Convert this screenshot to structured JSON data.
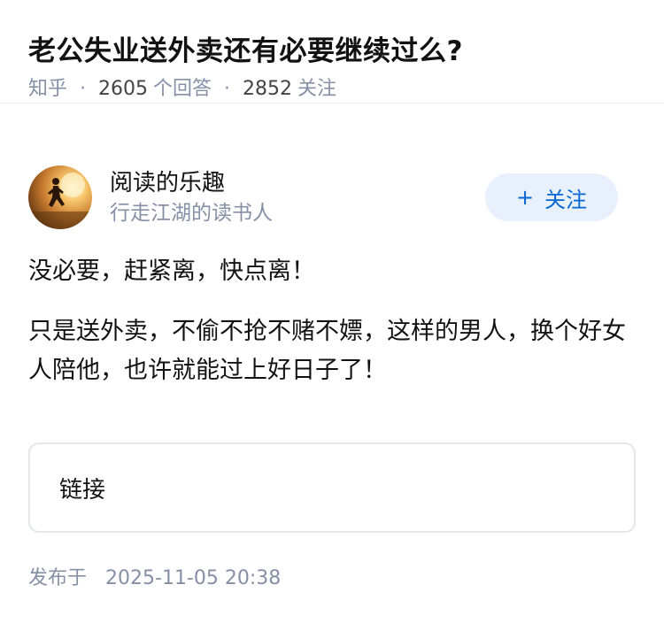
{
  "question": {
    "title": "老公失业送外卖还有必要继续过么?",
    "source": "知乎",
    "answer_count": "2605",
    "answer_label": "个回答",
    "follower_count": "2852",
    "follower_label": "关注",
    "separator": "·"
  },
  "author": {
    "name": "阅读的乐趣",
    "bio": "行走江湖的读书人",
    "avatar_icon": "runner-silhouette-avatar",
    "follow_plus": "+",
    "follow_label": "关注"
  },
  "answer": {
    "paragraphs": [
      "没必要，赶紧离，快点离！",
      "只是送外卖，不偷不抢不赌不嫖，这样的男人，换个好女人陪他，也许就能过上好日子了！"
    ],
    "link_label": "链接"
  },
  "footer": {
    "publish_label": "发布于",
    "publish_date": "2025-11-05 20:38"
  },
  "colors": {
    "accent": "#0566d4",
    "follow_bg": "#e8f1fb",
    "meta": "#8590a6",
    "text": "#121212"
  }
}
